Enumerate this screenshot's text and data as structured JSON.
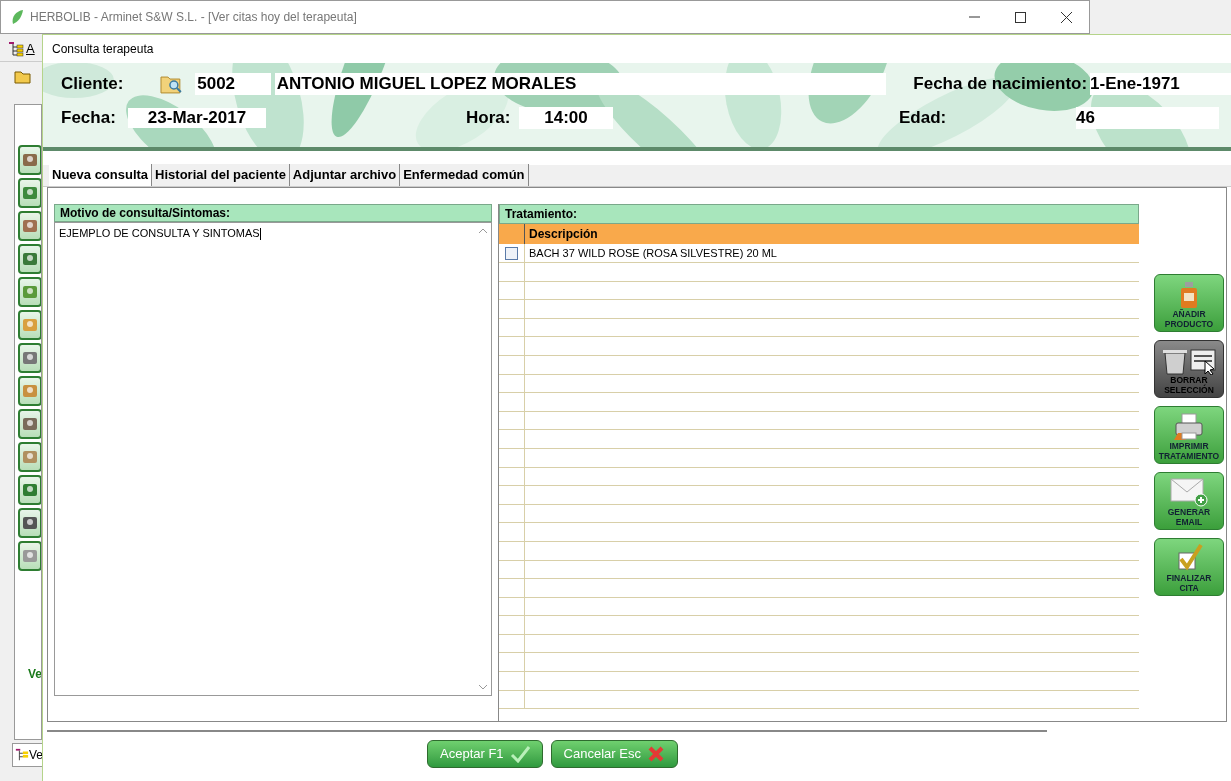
{
  "main_window": {
    "title": "HERBOLIB - Arminet S&W S.L. - [Ver citas hoy del terapeuta]",
    "toolbar_label": "A",
    "sidebar_caption": "Ve",
    "bottom_tab": "Ve"
  },
  "dialog": {
    "title": "Consulta terapeuta",
    "header": {
      "client_label": "Cliente:",
      "client_code": "5002",
      "client_name": "ANTONIO MIGUEL LOPEZ MORALES",
      "birth_label": "Fecha de nacimiento:",
      "birth_value": "1-Ene-1971",
      "date_label": "Fecha:",
      "date_value": "23-Mar-2017",
      "time_label": "Hora:",
      "time_value": "14:00",
      "age_label": "Edad:",
      "age_value": "46"
    },
    "tabs": [
      {
        "label": "Nueva consulta",
        "selected": true
      },
      {
        "label": "Historial del paciente",
        "selected": false
      },
      {
        "label": "Adjuntar archivo",
        "selected": false
      },
      {
        "label": "Enfermedad común",
        "selected": false
      }
    ],
    "symptoms": {
      "title": "Motivo de consulta/Sintomas:",
      "value": "EJEMPLO DE CONSULTA Y SINTOMAS"
    },
    "treatment": {
      "title": "Tratamiento:",
      "columns": [
        "Descripción"
      ],
      "rows": [
        {
          "description": "BACH 37 WILD ROSE (ROSA SILVESTRE) 20 ML",
          "checked": false
        }
      ]
    },
    "side_buttons": [
      {
        "label": "AÑADIR PRODUCTO",
        "kind": "bottle",
        "disabled": false
      },
      {
        "label": "BORRAR SELECCIÓN",
        "kind": "trash",
        "disabled": true
      },
      {
        "label": "IMPRIMIR TRATAMIENTO",
        "kind": "printer",
        "disabled": false
      },
      {
        "label": "GENERAR EMAIL",
        "kind": "mail",
        "disabled": false
      },
      {
        "label": "FINALIZAR CITA",
        "kind": "check",
        "disabled": false
      }
    ],
    "footer_buttons": [
      {
        "label": "Aceptar F1",
        "kind": "accept"
      },
      {
        "label": "Cancelar Esc",
        "kind": "cancel"
      }
    ]
  }
}
